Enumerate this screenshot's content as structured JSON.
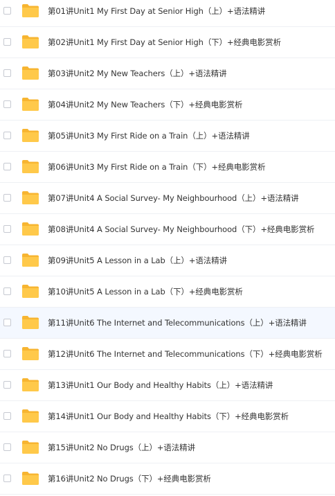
{
  "colors": {
    "folder_body": "#FFC94A",
    "folder_tab": "#F7B531",
    "text": "#333333",
    "row_divider": "#EEF0F4",
    "hover_bg": "#F4F8FF"
  },
  "files": [
    {
      "name": "第01讲Unit1 My First Day at Senior High（上）+语法精讲",
      "icon": "folder-icon",
      "hovered": false
    },
    {
      "name": "第02讲Unit1 My First Day at Senior High（下）+经典电影赏析",
      "icon": "folder-icon",
      "hovered": false
    },
    {
      "name": "第03讲Unit2 My New Teachers（上）+语法精讲",
      "icon": "folder-icon",
      "hovered": false
    },
    {
      "name": "第04讲Unit2 My New Teachers（下）+经典电影赏析",
      "icon": "folder-icon",
      "hovered": false
    },
    {
      "name": "第05讲Unit3 My First Ride on a Train（上）+语法精讲",
      "icon": "folder-icon",
      "hovered": false
    },
    {
      "name": "第06讲Unit3 My First Ride on a Train（下）+经典电影赏析",
      "icon": "folder-icon",
      "hovered": false
    },
    {
      "name": "第07讲Unit4 A Social Survey- My Neighbourhood（上）+语法精讲",
      "icon": "folder-icon",
      "hovered": false
    },
    {
      "name": "第08讲Unit4 A Social Survey- My Neighbourhood（下）+经典电影赏析",
      "icon": "folder-icon",
      "hovered": false
    },
    {
      "name": "第09讲Unit5 A Lesson in a Lab（上）+语法精讲",
      "icon": "folder-icon",
      "hovered": false
    },
    {
      "name": "第10讲Unit5 A Lesson in a Lab（下）+经典电影赏析",
      "icon": "folder-icon",
      "hovered": false
    },
    {
      "name": "第11讲Unit6 The Internet and Telecommunications（上）+语法精讲",
      "icon": "folder-icon",
      "hovered": true
    },
    {
      "name": "第12讲Unit6 The Internet and Telecommunications（下）+经典电影赏析",
      "icon": "folder-icon",
      "hovered": false
    },
    {
      "name": "第13讲Unit1 Our Body and Healthy Habits（上）+语法精讲",
      "icon": "folder-icon",
      "hovered": false
    },
    {
      "name": "第14讲Unit1 Our Body and Healthy Habits（下）+经典电影赏析",
      "icon": "folder-icon",
      "hovered": false
    },
    {
      "name": "第15讲Unit2 No Drugs（上）+语法精讲",
      "icon": "folder-icon",
      "hovered": false
    },
    {
      "name": "第16讲Unit2 No Drugs（下）+经典电影赏析",
      "icon": "folder-icon",
      "hovered": false
    }
  ]
}
